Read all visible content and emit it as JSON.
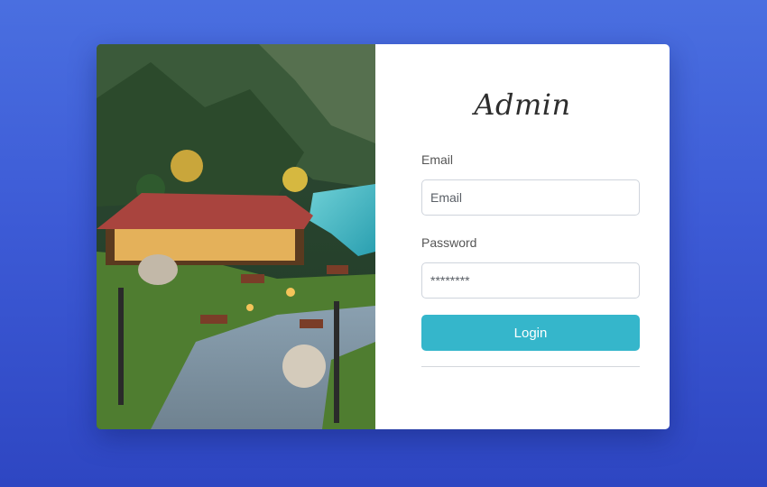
{
  "login": {
    "title": "Admin",
    "email_label": "Email",
    "email_placeholder": "Email",
    "password_label": "Password",
    "password_value": "********",
    "login_button": "Login"
  },
  "colors": {
    "background": "#3d5bd6",
    "button": "#35b6cb",
    "card": "#ffffff"
  }
}
